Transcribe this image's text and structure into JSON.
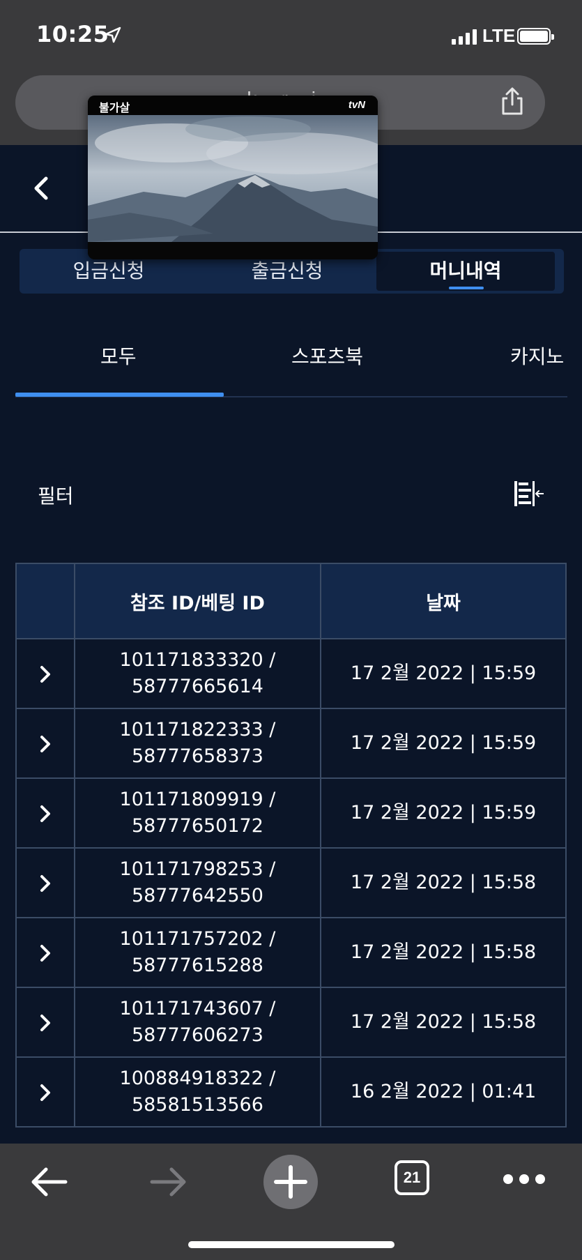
{
  "status_bar": {
    "time": "10:25",
    "network": "LTE"
  },
  "browser": {
    "url_text": "...k...r...i...",
    "tab_count": "21"
  },
  "video": {
    "show_logo": "불가살",
    "channel_logo": "tvN"
  },
  "main_tabs": [
    {
      "label": "입금신청",
      "active": false
    },
    {
      "label": "출금신청",
      "active": false
    },
    {
      "label": "머니내역",
      "active": true
    }
  ],
  "sub_tabs": [
    {
      "label": "모두",
      "active": true
    },
    {
      "label": "스포츠북",
      "active": false
    },
    {
      "label": "카지노",
      "active": false
    }
  ],
  "filter": {
    "label": "필터"
  },
  "table": {
    "headers": [
      "",
      "참조 ID/베팅 ID",
      "날짜"
    ],
    "rows": [
      {
        "ref_id": "101171833320 /",
        "bet_id": "58777665614",
        "date": "17 2월 2022 | 15:59"
      },
      {
        "ref_id": "101171822333 /",
        "bet_id": "58777658373",
        "date": "17 2월 2022 | 15:59"
      },
      {
        "ref_id": "101171809919 /",
        "bet_id": "58777650172",
        "date": "17 2월 2022 | 15:59"
      },
      {
        "ref_id": "101171798253 /",
        "bet_id": "58777642550",
        "date": "17 2월 2022 | 15:58"
      },
      {
        "ref_id": "101171757202 /",
        "bet_id": "58777615288",
        "date": "17 2월 2022 | 15:58"
      },
      {
        "ref_id": "101171743607 /",
        "bet_id": "58777606273",
        "date": "17 2월 2022 | 15:58"
      },
      {
        "ref_id": "100884918322 /",
        "bet_id": "58581513566",
        "date": "16 2월 2022 | 01:41"
      }
    ]
  },
  "icons": {
    "location": "location-arrow-icon",
    "share": "share-icon",
    "back": "chevron-left-icon",
    "filter": "filter-collapse-icon",
    "row_expand": "chevron-right-icon",
    "toolbar": [
      "arrow-left-icon",
      "arrow-right-icon",
      "plus-icon",
      "tabs-icon",
      "more-icon"
    ]
  },
  "colors": {
    "page_bg": "#0b1528",
    "tab_bg": "#13284a",
    "accent": "#3f8ff0",
    "browser_chrome": "#3a3a3c"
  }
}
